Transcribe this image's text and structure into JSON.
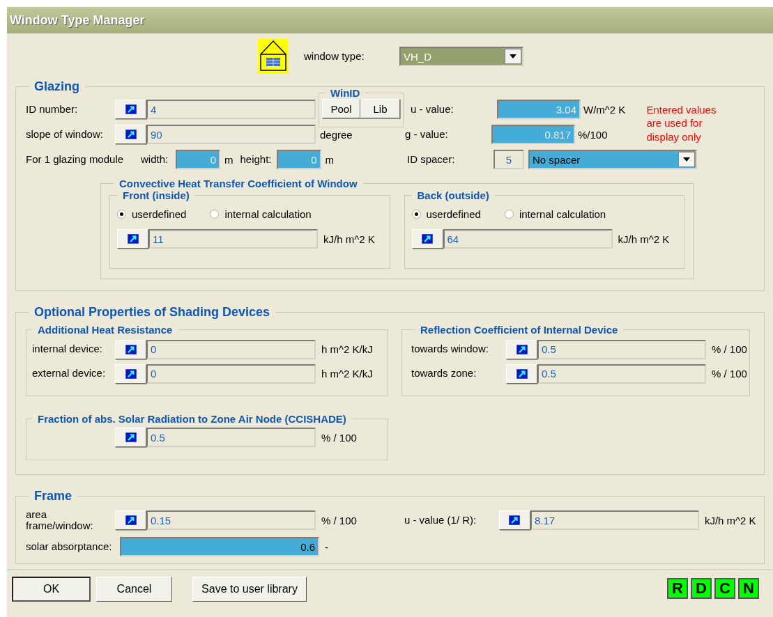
{
  "window": {
    "title": "Window Type Manager"
  },
  "window_type": {
    "label": "window type:",
    "value": "VH_D"
  },
  "glazing": {
    "title": "Glazing",
    "id_number": {
      "label": "ID number:",
      "kind": "picker",
      "value": "4"
    },
    "slope": {
      "label": "slope of window:",
      "kind": "picker",
      "value": "90",
      "unit": "degree"
    },
    "winid": {
      "title": "WinID",
      "buttons": [
        "Pool",
        "Lib"
      ]
    },
    "u_value": {
      "label": "u - value:",
      "kind": "entry",
      "disabled": true,
      "value": "3.04",
      "unit": "W/m^2 K"
    },
    "g_value": {
      "label": "g - value:",
      "kind": "entry",
      "disabled": true,
      "value": "0.817",
      "unit": "%/100"
    },
    "note": "Entered values\nare used for\ndisplay only",
    "module": {
      "label": "For 1 glazing module",
      "width": {
        "label": "width:",
        "kind": "entry",
        "disabled": true,
        "value": "0",
        "unit": "m"
      },
      "height": {
        "label": "height:",
        "kind": "entry",
        "disabled": true,
        "value": "0",
        "unit": "m"
      }
    },
    "spacer": {
      "label": "ID spacer:",
      "id": "5",
      "value": "No spacer"
    },
    "convective": {
      "title": "Convective Heat Transfer Coefficient of Window",
      "sides": [
        {
          "title": "Front (inside)",
          "options": [
            {
              "label": "userdefined",
              "selected": true
            },
            {
              "label": "internal calculation",
              "selected": false
            }
          ],
          "field": {
            "kind": "picker",
            "value": "11",
            "unit": "kJ/h m^2 K"
          }
        },
        {
          "title": "Back (outside)",
          "options": [
            {
              "label": "userdefined",
              "selected": true
            },
            {
              "label": "internal calculation",
              "selected": false
            }
          ],
          "field": {
            "kind": "picker",
            "value": "64",
            "unit": "kJ/h m^2 K"
          }
        }
      ]
    }
  },
  "shading": {
    "title": "Optional Properties of Shading Devices",
    "resistance": {
      "title": "Additional Heat Resistance",
      "rows": [
        {
          "label": "internal device:",
          "kind": "picker",
          "value": "0",
          "unit": "h m^2 K/kJ"
        },
        {
          "label": "external device:",
          "kind": "picker",
          "value": "0",
          "unit": "h m^2 K/kJ"
        }
      ]
    },
    "reflection": {
      "title": "Reflection Coefficient of Internal Device",
      "rows": [
        {
          "label": "towards window:",
          "kind": "picker",
          "value": "0.5",
          "unit": "% / 100"
        },
        {
          "label": "towards zone:",
          "kind": "picker",
          "value": "0.5",
          "unit": "% / 100"
        }
      ]
    },
    "fraction": {
      "title": "Fraction of abs. Solar Radiation to Zone Air Node (CCISHADE)",
      "field": {
        "kind": "picker",
        "value": "0.5",
        "unit": "% / 100"
      }
    }
  },
  "frame": {
    "title": "Frame",
    "area": {
      "label": "area\nframe/window:",
      "kind": "picker",
      "value": "0.15",
      "unit": "% / 100"
    },
    "u_value": {
      "label": "u - value (1/ R):",
      "kind": "picker",
      "value": "8.17",
      "unit": "kJ/h m^2 K"
    },
    "solar": {
      "label": "solar absorptance:",
      "kind": "entry",
      "disabled": false,
      "value": "0.6",
      "unit": "-"
    }
  },
  "buttons": [
    "OK",
    "Cancel",
    "Save to user library"
  ],
  "corner_buttons": [
    "R",
    "D",
    "C",
    "N"
  ]
}
